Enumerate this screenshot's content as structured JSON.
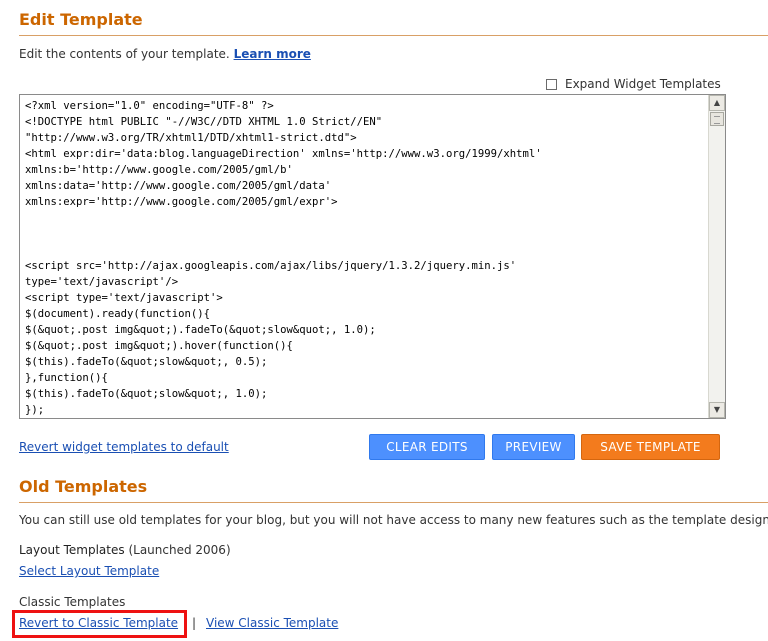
{
  "edit_template": {
    "title": "Edit Template",
    "description": "Edit the contents of your template.",
    "learn_more": "Learn more",
    "expand_widget_label": "Expand Widget Templates",
    "expand_widget_checked": false,
    "code_lines": [
      "<?xml version=\"1.0\" encoding=\"UTF-8\" ?>",
      "<!DOCTYPE html PUBLIC \"-//W3C//DTD XHTML 1.0 Strict//EN\"",
      "\"http://www.w3.org/TR/xhtml1/DTD/xhtml1-strict.dtd\">",
      "<html expr:dir='data:blog.languageDirection' xmlns='http://www.w3.org/1999/xhtml'",
      "xmlns:b='http://www.google.com/2005/gml/b'",
      "xmlns:data='http://www.google.com/2005/gml/data'",
      "xmlns:expr='http://www.google.com/2005/gml/expr'>",
      "",
      "",
      "",
      "<script src='http://ajax.googleapis.com/ajax/libs/jquery/1.3.2/jquery.min.js'",
      "type='text/javascript'/>",
      "<script type='text/javascript'>",
      "$(document).ready(function(){",
      "$(&quot;.post img&quot;).fadeTo(&quot;slow&quot;, 1.0);",
      "$(&quot;.post img&quot;).hover(function(){",
      "$(this).fadeTo(&quot;slow&quot;, 0.5);",
      "},function(){",
      "$(this).fadeTo(&quot;slow&quot;, 1.0);",
      "});"
    ],
    "revert_widget_link": "Revert widget templates to default",
    "buttons": {
      "clear": "CLEAR EDITS",
      "preview": "PREVIEW",
      "save": "SAVE TEMPLATE"
    }
  },
  "old_templates": {
    "title": "Old Templates",
    "description": "You can still use old templates for your blog, but you will not have access to many new features such as the template designer.",
    "layout_label": "Layout Templates",
    "layout_launched": "(Launched 2006)",
    "select_layout_link": "Select Layout Template",
    "classic_label": "Classic Templates",
    "revert_classic_link": "Revert to Classic Template",
    "separator": "|",
    "view_classic_link": "View Classic Template"
  },
  "colors": {
    "heading": "#cc6600",
    "link": "#1a4fb3",
    "button_blue": "#4d90fe",
    "button_orange": "#f37b1d",
    "highlight": "#ee1111"
  },
  "icons": {
    "scroll_up": "▲",
    "scroll_down": "▼"
  }
}
